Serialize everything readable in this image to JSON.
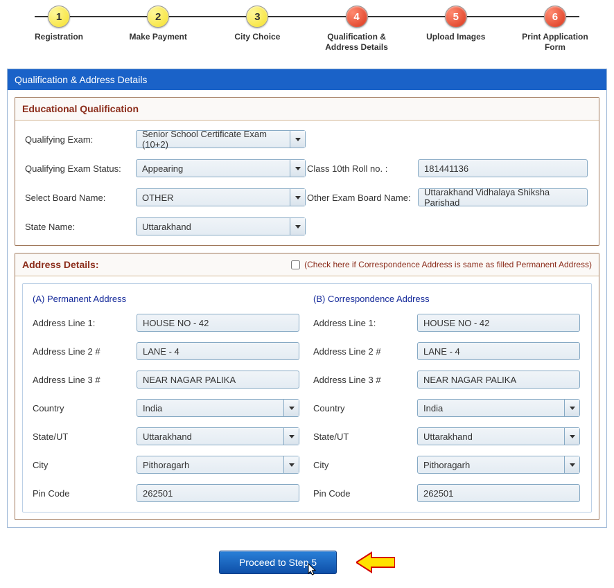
{
  "steps": [
    {
      "num": "1",
      "label": "Registration",
      "color": "yellow"
    },
    {
      "num": "2",
      "label": "Make Payment",
      "color": "yellow"
    },
    {
      "num": "3",
      "label": "City Choice",
      "color": "yellow"
    },
    {
      "num": "4",
      "label": "Qualification & Address Details",
      "color": "red"
    },
    {
      "num": "5",
      "label": "Upload Images",
      "color": "red"
    },
    {
      "num": "6",
      "label": "Print Application Form",
      "color": "red"
    }
  ],
  "main_header": "Qualification & Address Details",
  "edu": {
    "title": "Educational Qualification",
    "labels": {
      "qexam": "Qualifying Exam:",
      "qstatus": "Qualifying Exam Status:",
      "board": "Select Board Name:",
      "state": "State Name:",
      "roll": "Class 10th Roll no. :",
      "otherboard": "Other Exam Board Name:"
    },
    "values": {
      "qexam": "Senior School Certificate Exam (10+2)",
      "qstatus": "Appearing",
      "board": "OTHER",
      "state": "Uttarakhand",
      "roll": "181441136",
      "otherboard": "Uttarakhand Vidhalaya Shiksha Parishad"
    }
  },
  "addr": {
    "title": "Address Details:",
    "checkbox_label": "(Check here if Correspondence Address is same as filled Permanent Address)",
    "perm_heading": "(A) Permanent Address",
    "corr_heading": "(B) Correspondence Address",
    "labels": {
      "l1": "Address Line 1:",
      "l2": "Address Line 2 #",
      "l3": "Address Line 3 #",
      "country": "Country",
      "state": "State/UT",
      "city": "City",
      "pin": "Pin Code"
    },
    "perm": {
      "l1": "HOUSE NO - 42",
      "l2": "LANE - 4",
      "l3": "NEAR NAGAR PALIKA",
      "country": "India",
      "state": "Uttarakhand",
      "city": "Pithoragarh",
      "pin": "262501"
    },
    "corr": {
      "l1": "HOUSE NO - 42",
      "l2": "LANE - 4",
      "l3": "NEAR NAGAR PALIKA",
      "country": "India",
      "state": "Uttarakhand",
      "city": "Pithoragarh",
      "pin": "262501"
    }
  },
  "proceed_label": "Proceed to Step 5"
}
